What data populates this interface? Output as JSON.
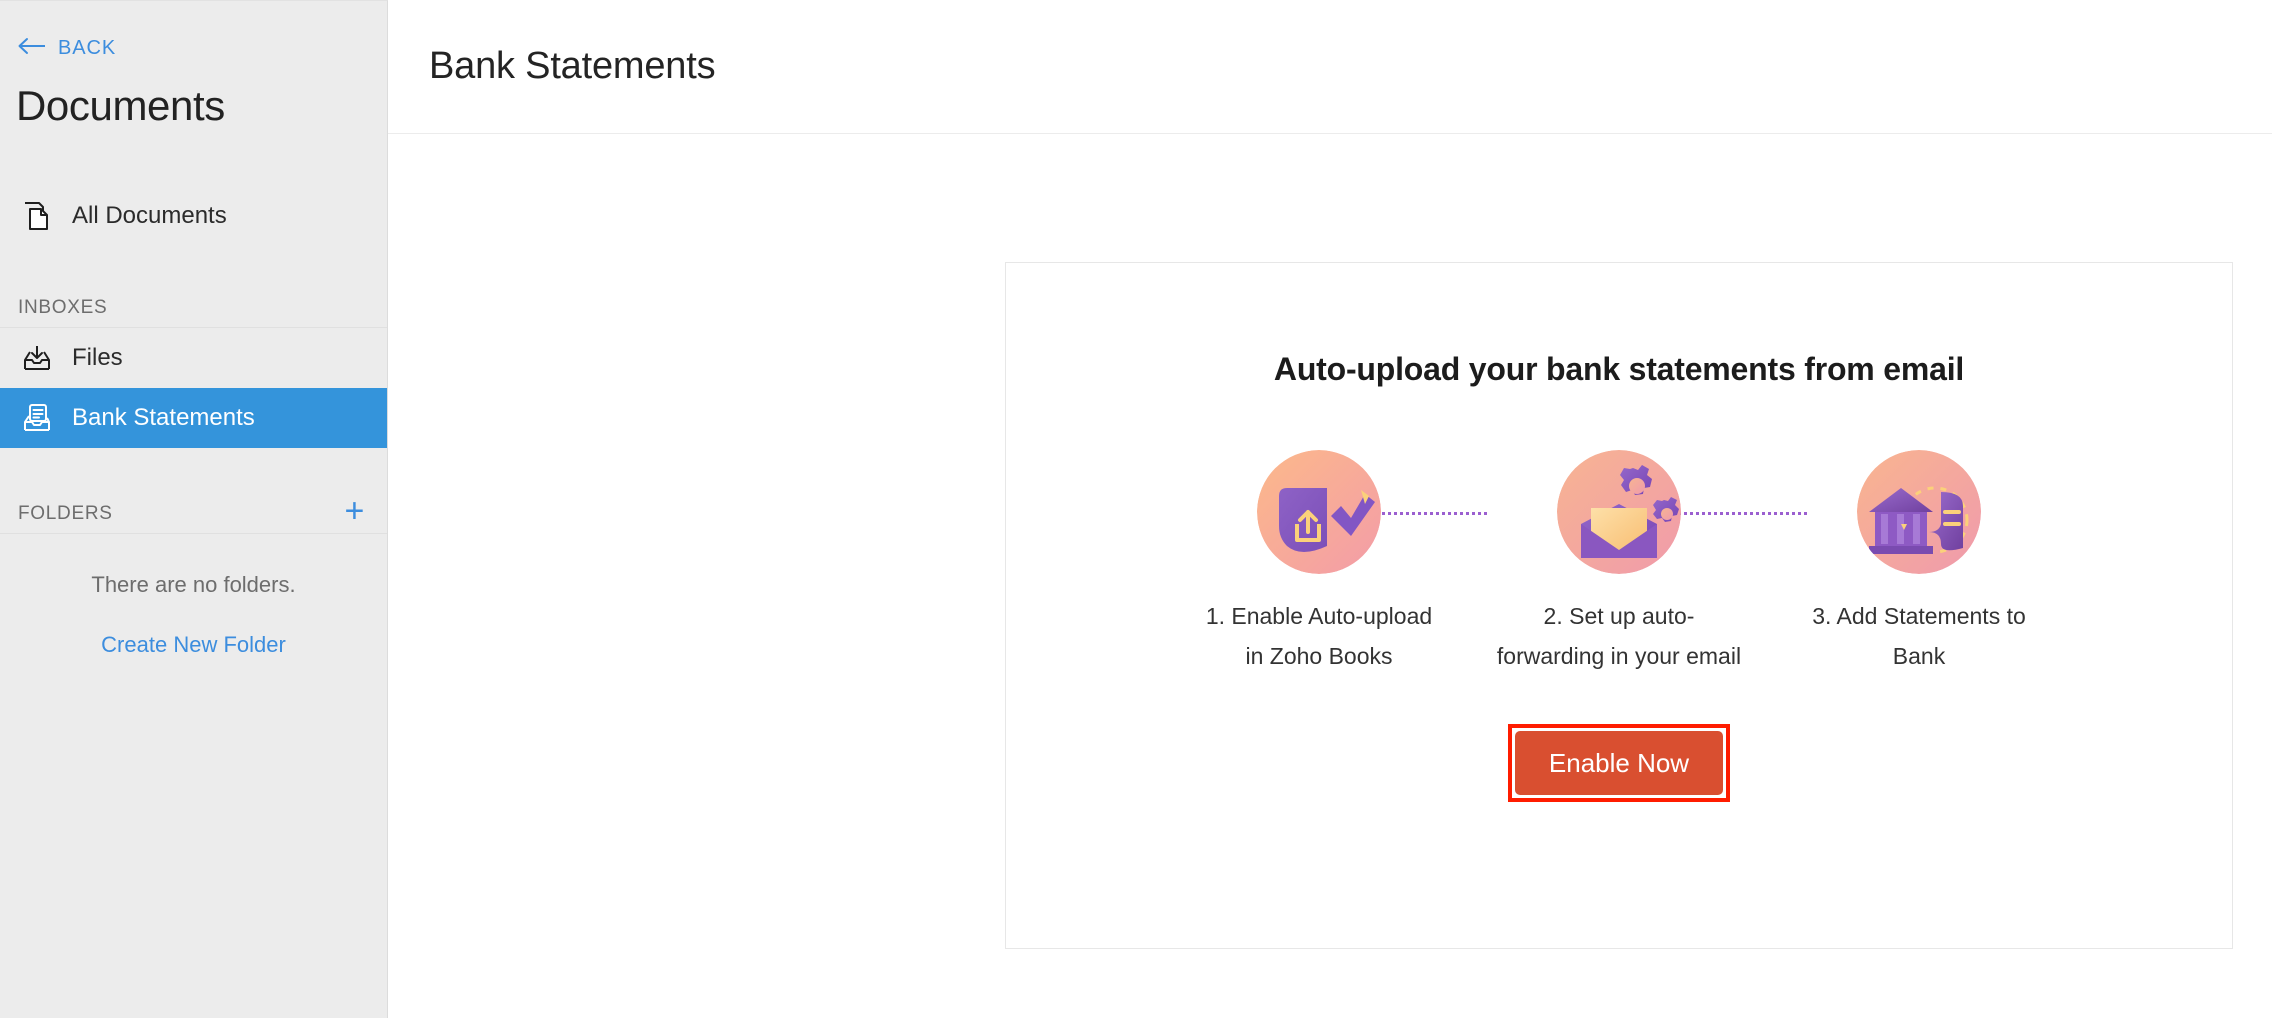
{
  "sidebar": {
    "back_label": "BACK",
    "back_icon": "arrow-left-icon",
    "title": "Documents",
    "all_documents": {
      "label": "All Documents",
      "icon": "documents-copy-icon"
    },
    "inboxes_header": "INBOXES",
    "inbox_items": [
      {
        "label": "Files",
        "icon": "inbox-download-icon",
        "selected": false
      },
      {
        "label": "Bank Statements",
        "icon": "inbox-statement-icon",
        "selected": true
      }
    ],
    "folders_header": "FOLDERS",
    "add_folder_icon": "plus-icon",
    "folders_empty_text": "There are no folders.",
    "create_folder_label": "Create New Folder"
  },
  "header": {
    "title": "Bank Statements"
  },
  "promo": {
    "title": "Auto-upload your bank statements from email",
    "steps": [
      {
        "label": "1. Enable Auto-upload in Zoho Books",
        "icon": "upload-check-icon"
      },
      {
        "label": "2. Set up auto-forwarding in your email",
        "icon": "email-gears-icon"
      },
      {
        "label": "3. Add Statements to Bank",
        "icon": "bank-statement-icon"
      }
    ],
    "cta_label": "Enable Now"
  },
  "colors": {
    "accent_blue": "#3494db",
    "link_blue": "#3c8dde",
    "sidebar_bg": "#ececec",
    "cta_bg": "#d94f30",
    "annotation_red": "#ff1c00",
    "connector_purple": "#9b5fd0"
  }
}
